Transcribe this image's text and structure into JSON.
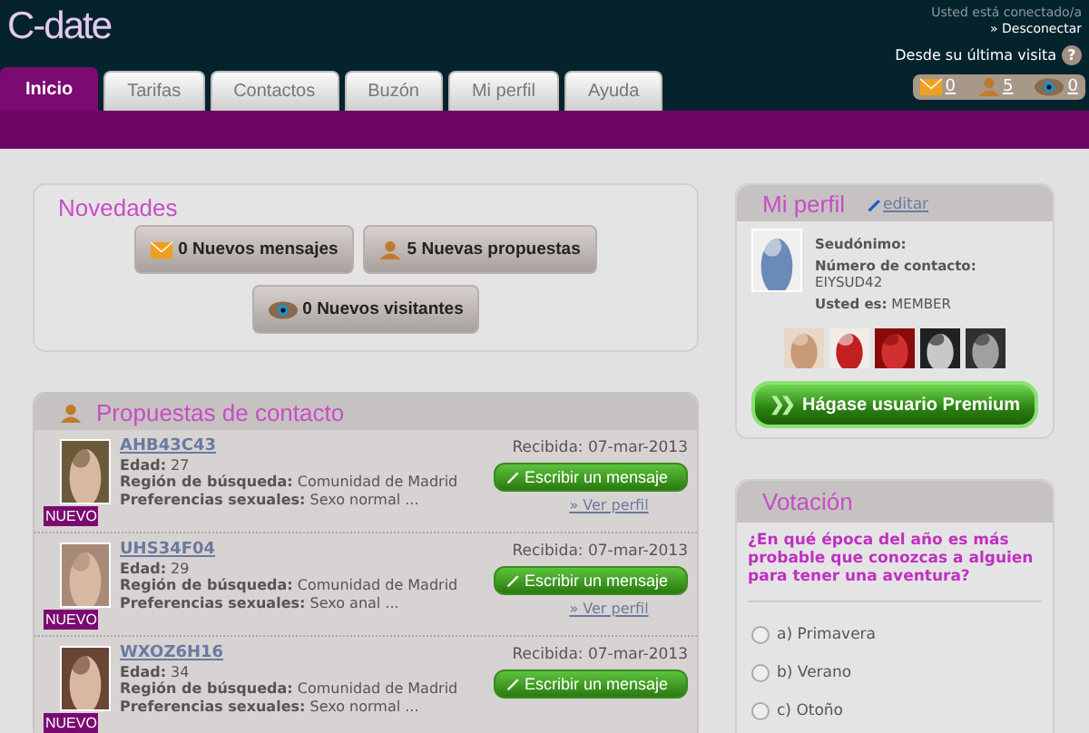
{
  "header": {
    "logo": "C-date",
    "status": "Usted está conectado/a",
    "logout": "» Desconectar",
    "since_last": "Desde su última visita",
    "help": "?",
    "counters": [
      {
        "kind": "mail",
        "count": "0"
      },
      {
        "kind": "person",
        "count": "5"
      },
      {
        "kind": "eye",
        "count": "0"
      }
    ]
  },
  "tabs": [
    {
      "label": "Inicio",
      "selected": true
    },
    {
      "label": "Tarifas",
      "selected": false
    },
    {
      "label": "Contactos",
      "selected": false
    },
    {
      "label": "Buzón",
      "selected": false
    },
    {
      "label": "Mi perfil",
      "selected": false
    },
    {
      "label": "Ayuda",
      "selected": false
    }
  ],
  "news": {
    "title": "Novedades",
    "buttons": [
      {
        "kind": "mail",
        "label": "0 Nuevos mensajes"
      },
      {
        "kind": "person",
        "label": "5 Nuevas propuestas"
      },
      {
        "kind": "eye",
        "label": "0 Nuevos visitantes"
      }
    ]
  },
  "proposals": {
    "title": "Propuestas de contacto",
    "rows": [
      {
        "name": "AHB43C43",
        "badge": "NUEVO",
        "age_label": "Edad:",
        "age": "27",
        "region_label": "Región de búsqueda:",
        "region": "Comunidad de Madrid",
        "pref_label": "Preferencias sexuales:",
        "pref": "Sexo normal ...",
        "received": "Recibida: 07-mar-2013",
        "write": "Escribir un mensaje",
        "view": "» Ver perfil"
      },
      {
        "name": "UHS34F04",
        "badge": "NUEVO",
        "age_label": "Edad:",
        "age": "29",
        "region_label": "Región de búsqueda:",
        "region": "Comunidad de Madrid",
        "pref_label": "Preferencias sexuales:",
        "pref": "Sexo anal ...",
        "received": "Recibida: 07-mar-2013",
        "write": "Escribir un mensaje",
        "view": "» Ver perfil"
      },
      {
        "name": "WXOZ6H16",
        "badge": "NUEVO",
        "age_label": "Edad:",
        "age": "34",
        "region_label": "Región de búsqueda:",
        "region": "Comunidad de Madrid",
        "pref_label": "Preferencias sexuales:",
        "pref": "Sexo normal ...",
        "received": "Recibida: 07-mar-2013",
        "write": "Escribir un mensaje"
      }
    ]
  },
  "profile": {
    "title": "Mi perfil",
    "edit": "editar",
    "nick_label": "Seudónimo:",
    "contact_label": "Número de contacto:",
    "contact": "EIYSUD42",
    "type_label": "Usted es:",
    "type": "MEMBER",
    "premium_icon": "❯❯",
    "premium": "Hágase usuario Premium"
  },
  "poll": {
    "title": "Votación",
    "question": "¿En qué época del año es más probable que conozcas a alguien para tener una aventura?",
    "options": [
      {
        "label": "a) Primavera",
        "selected": false
      },
      {
        "label": "b) Verano",
        "selected": false
      },
      {
        "label": "c) Otoño",
        "selected": false
      }
    ]
  }
}
